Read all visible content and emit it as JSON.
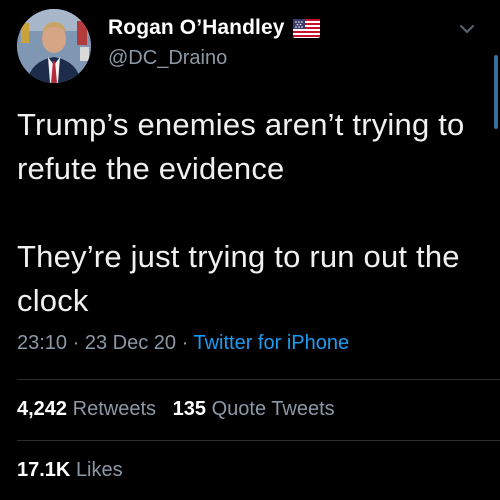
{
  "user": {
    "name": "Rogan O’Handley",
    "handle": "@DC_Draino",
    "flag_icon": "us-flag-icon"
  },
  "tweet": {
    "text": "Trump’s enemies aren’t trying to refute the evidence\n\nThey’re just trying to run out the clock",
    "time": "23:10",
    "date": "23 Dec 20",
    "separator": "·",
    "source": "Twitter for iPhone"
  },
  "stats": {
    "retweets_count": "4,242",
    "retweets_label": "Retweets",
    "quotes_count": "135",
    "quotes_label": "Quote Tweets",
    "likes_count": "17.1K",
    "likes_label": "Likes"
  },
  "colors": {
    "background": "#000000",
    "text": "#ffffff",
    "secondary_text": "#8b98a5",
    "link": "#1d9bf0",
    "divider": "#2a2f33"
  }
}
